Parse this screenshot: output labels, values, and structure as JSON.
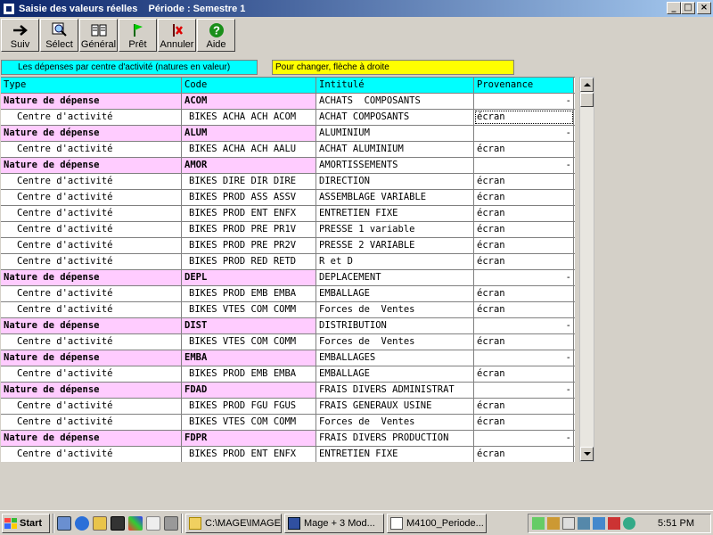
{
  "window": {
    "title": "Saisie des valeurs réelles    Période : Semestre 1",
    "controls": {
      "minimize": "_",
      "maximize": "□",
      "close": "×"
    }
  },
  "toolbar": [
    {
      "id": "suiv",
      "label": "Suiv",
      "icon": "arrow-right-icon"
    },
    {
      "id": "select",
      "label": "Sélect",
      "icon": "magnifier-icon"
    },
    {
      "id": "general",
      "label": "Général",
      "icon": "book-icon"
    },
    {
      "id": "pret",
      "label": "Prêt",
      "icon": "flag-icon"
    },
    {
      "id": "annuler",
      "label": "Annuler",
      "icon": "cancel-icon"
    },
    {
      "id": "aide",
      "label": "Aide",
      "icon": "help-icon"
    }
  ],
  "info": {
    "left": "Les dépenses par centre d'activité (natures en valeur)",
    "right": "Pour changer, flèche à droite"
  },
  "grid": {
    "headers": [
      "Type",
      "Code",
      "Intitulé",
      "Provenance"
    ],
    "rows": [
      {
        "kind": "nat",
        "type": "Nature de dépense",
        "code": "ACOM",
        "intitule": "ACHATS  COMPOSANTS",
        "prov": "",
        "minus": "-"
      },
      {
        "kind": "act",
        "type": "Centre d'activité",
        "code": "BIKES ACHA ACH ACOM",
        "intitule": "ACHAT COMPOSANTS",
        "prov": "écran"
      },
      {
        "kind": "nat",
        "type": "Nature de dépense",
        "code": "ALUM",
        "intitule": "ALUMINIUM",
        "prov": "",
        "minus": "-"
      },
      {
        "kind": "act",
        "type": "Centre d'activité",
        "code": "BIKES ACHA ACH AALU",
        "intitule": "ACHAT ALUMINIUM",
        "prov": "écran"
      },
      {
        "kind": "nat",
        "type": "Nature de dépense",
        "code": "AMOR",
        "intitule": "AMORTISSEMENTS",
        "prov": "",
        "minus": "-"
      },
      {
        "kind": "act",
        "type": "Centre d'activité",
        "code": "BIKES DIRE DIR DIRE",
        "intitule": "DIRECTION",
        "prov": "écran"
      },
      {
        "kind": "act",
        "type": "Centre d'activité",
        "code": "BIKES PROD ASS ASSV",
        "intitule": "ASSEMBLAGE VARIABLE",
        "prov": "écran"
      },
      {
        "kind": "act",
        "type": "Centre d'activité",
        "code": "BIKES PROD ENT ENFX",
        "intitule": "ENTRETIEN FIXE",
        "prov": "écran"
      },
      {
        "kind": "act",
        "type": "Centre d'activité",
        "code": "BIKES PROD PRE PR1V",
        "intitule": "PRESSE 1 variable",
        "prov": "écran"
      },
      {
        "kind": "act",
        "type": "Centre d'activité",
        "code": "BIKES PROD PRE PR2V",
        "intitule": "PRESSE 2 VARIABLE",
        "prov": "écran"
      },
      {
        "kind": "act",
        "type": "Centre d'activité",
        "code": "BIKES PROD RED RETD",
        "intitule": "R et D",
        "prov": "écran"
      },
      {
        "kind": "nat",
        "type": "Nature de dépense",
        "code": "DEPL",
        "intitule": "DEPLACEMENT",
        "prov": "",
        "minus": "-"
      },
      {
        "kind": "act",
        "type": "Centre d'activité",
        "code": "BIKES PROD EMB EMBA",
        "intitule": "EMBALLAGE",
        "prov": "écran"
      },
      {
        "kind": "act",
        "type": "Centre d'activité",
        "code": "BIKES VTES COM COMM",
        "intitule": "Forces de  Ventes",
        "prov": "écran"
      },
      {
        "kind": "nat",
        "type": "Nature de dépense",
        "code": "DIST",
        "intitule": "DISTRIBUTION",
        "prov": "",
        "minus": "-"
      },
      {
        "kind": "act",
        "type": "Centre d'activité",
        "code": "BIKES VTES COM COMM",
        "intitule": "Forces de  Ventes",
        "prov": "écran"
      },
      {
        "kind": "nat",
        "type": "Nature de dépense",
        "code": "EMBA",
        "intitule": "EMBALLAGES",
        "prov": "",
        "minus": "-"
      },
      {
        "kind": "act",
        "type": "Centre d'activité",
        "code": "BIKES PROD EMB EMBA",
        "intitule": "EMBALLAGE",
        "prov": "écran"
      },
      {
        "kind": "nat",
        "type": "Nature de dépense",
        "code": "FDAD",
        "intitule": "FRAIS DIVERS ADMINISTRAT",
        "prov": "",
        "minus": "-"
      },
      {
        "kind": "act",
        "type": "Centre d'activité",
        "code": "BIKES PROD FGU FGUS",
        "intitule": "FRAIS GENERAUX USINE",
        "prov": "écran"
      },
      {
        "kind": "act",
        "type": "Centre d'activité",
        "code": "BIKES VTES COM COMM",
        "intitule": "Forces de  Ventes",
        "prov": "écran"
      },
      {
        "kind": "nat",
        "type": "Nature de dépense",
        "code": "FDPR",
        "intitule": "FRAIS DIVERS PRODUCTION",
        "prov": "",
        "minus": "-"
      },
      {
        "kind": "act",
        "type": "Centre d'activité",
        "code": "BIKES PROD ENT ENFX",
        "intitule": "ENTRETIEN FIXE",
        "prov": "écran"
      }
    ]
  },
  "taskbar": {
    "start_label": "Start",
    "tasks": [
      {
        "label": "C:\\MAGE\\IMAGES",
        "icon": "folder-icon"
      },
      {
        "label": "Mage + 3   Mod...",
        "icon": "app-icon"
      },
      {
        "label": "M4100_Periode...",
        "icon": "document-icon"
      }
    ],
    "clock": "5:51 PM"
  },
  "colors": {
    "titlebar_start": "#0a246a",
    "header_bg": "#00ffff",
    "nature_bg": "#ffccff",
    "hint_bg": "#ffff00"
  }
}
